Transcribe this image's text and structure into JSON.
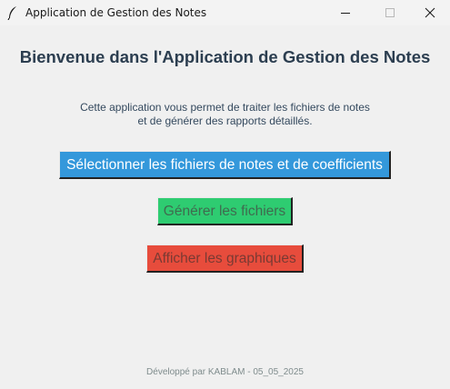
{
  "window": {
    "title": "Application de Gestion des Notes",
    "icon": "feather-icon"
  },
  "main": {
    "heading": "Bienvenue dans l'Application de Gestion des Notes",
    "description_line1": "Cette application vous permet de traiter les fichiers de notes",
    "description_line2": "et de générer des rapports détaillés."
  },
  "buttons": {
    "select_files": "Sélectionner les fichiers de notes et de coefficients",
    "generate_files": "Générer les fichiers",
    "show_graphs": "Afficher les graphiques"
  },
  "footer": {
    "text": "Développé par KABLAM - 05_05_2025"
  },
  "colors": {
    "heading": "#2c3e50",
    "select_button": "#3498db",
    "generate_button": "#2ecc71",
    "graphs_button": "#e74c3c",
    "footer": "#7f8c8d"
  }
}
